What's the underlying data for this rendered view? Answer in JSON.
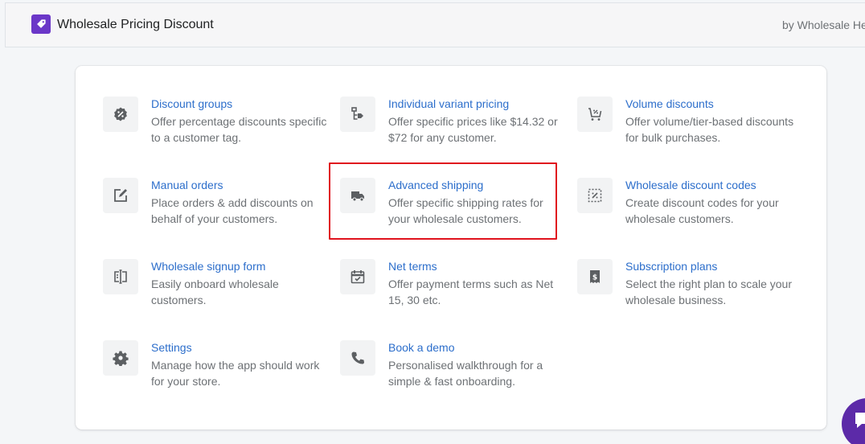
{
  "header": {
    "title": "Wholesale Pricing Discount",
    "byline": "by Wholesale He"
  },
  "brand_color": "#6b37c8",
  "link_color": "#2c6ecb",
  "highlight_color": "#e0141e",
  "items": [
    {
      "title": "Discount groups",
      "desc": "Offer percentage discounts specific to a customer tag.",
      "icon": "percent-badge-icon"
    },
    {
      "title": "Individual variant pricing",
      "desc": "Offer specific prices like $14.32 or $72 for any customer.",
      "icon": "variant-tag-icon"
    },
    {
      "title": "Volume discounts",
      "desc": "Offer volume/tier-based discounts for bulk purchases.",
      "icon": "cart-discount-icon"
    },
    {
      "title": "Manual orders",
      "desc": "Place orders & add discounts on behalf of your customers.",
      "icon": "edit-icon"
    },
    {
      "title": "Advanced shipping",
      "desc": "Offer specific shipping rates for your wholesale customers.",
      "icon": "truck-icon"
    },
    {
      "title": "Wholesale discount codes",
      "desc": "Create discount codes for your wholesale customers.",
      "icon": "discount-code-icon"
    },
    {
      "title": "Wholesale signup form",
      "desc": "Easily onboard wholesale customers.",
      "icon": "form-icon"
    },
    {
      "title": "Net terms",
      "desc": "Offer payment terms such as Net 15, 30 etc.",
      "icon": "calendar-icon"
    },
    {
      "title": "Subscription plans",
      "desc": "Select the right plan to scale your wholesale business.",
      "icon": "receipt-icon"
    },
    {
      "title": "Settings",
      "desc": "Manage how the app should work for your store.",
      "icon": "gear-icon"
    },
    {
      "title": "Book a demo",
      "desc": "Personalised walkthrough for a simple & fast onboarding.",
      "icon": "phone-icon"
    }
  ]
}
